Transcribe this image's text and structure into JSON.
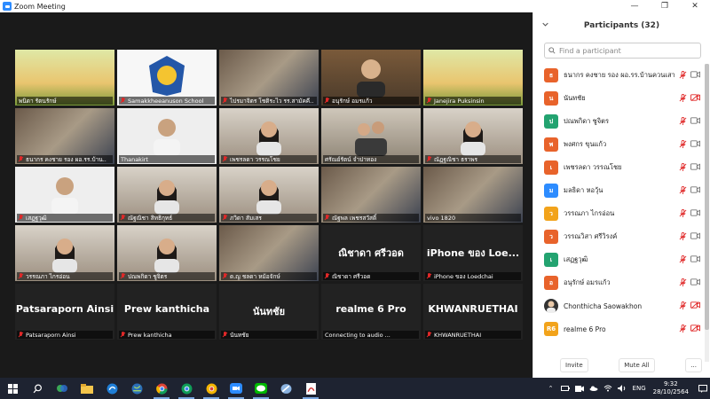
{
  "window": {
    "title": "Zoom Meeting"
  },
  "gallery": {
    "tiles": [
      {
        "name": "พนิดา รัตนรักษ์",
        "kind": "cam",
        "muted": false,
        "scene": "poster"
      },
      {
        "name": "Samakkheeanuson School",
        "kind": "cam",
        "muted": true,
        "scene": "logo"
      },
      {
        "name": "ไปรมาจิตร โชติระไว รร.สามัคคี..",
        "kind": "cam",
        "muted": true,
        "scene": "room"
      },
      {
        "name": "อนุรักษ์ อมรแก้ว",
        "kind": "cam",
        "muted": true,
        "scene": "person"
      },
      {
        "name": "Janejira Puksinsin",
        "kind": "cam",
        "muted": true,
        "scene": "poster"
      },
      {
        "name": "ธนากร คงชาย รอง ผอ.รร.บ้าน..",
        "kind": "cam",
        "muted": true,
        "scene": "room"
      },
      {
        "name": "Thanakirt",
        "kind": "cam",
        "muted": false,
        "scene": "kid"
      },
      {
        "name": "เพชรลดา วรรณโชย",
        "kind": "cam",
        "muted": true,
        "scene": "girl"
      },
      {
        "name": "ศรัณย์รัตน์ จำปาทอง",
        "kind": "cam",
        "muted": false,
        "scene": "group",
        "active": true
      },
      {
        "name": "ณัฏฐณิชา ธราพร",
        "kind": "cam",
        "muted": true,
        "scene": "girl"
      },
      {
        "name": "เสฏฐวุฒิ",
        "kind": "cam",
        "muted": true,
        "scene": "kid"
      },
      {
        "name": "ณัฐณิชา สิทธิกุทธ์",
        "kind": "cam",
        "muted": true,
        "scene": "girl"
      },
      {
        "name": "ภวิดา สัมเสร",
        "kind": "cam",
        "muted": true,
        "scene": "girl"
      },
      {
        "name": "ณัฐพล เพชรสวัสดิ์",
        "kind": "cam",
        "muted": true,
        "scene": "room"
      },
      {
        "name": "vivo 1820",
        "kind": "cam",
        "muted": false,
        "scene": "room"
      },
      {
        "name": "วรรณภา ไกรอ่อน",
        "kind": "cam",
        "muted": true,
        "scene": "girl"
      },
      {
        "name": "ปณพกิดา ชูจิตร",
        "kind": "cam",
        "muted": true,
        "scene": "girl"
      },
      {
        "name": "ด.ญ ชลดา หม้อจักษ์",
        "kind": "cam",
        "muted": true,
        "scene": "room"
      },
      {
        "name": "ณิชาดา ศรีวอด",
        "kind": "name",
        "big": "ณิชาดา ศรีวอด",
        "muted": true
      },
      {
        "name": "iPhone ของ Loedchai",
        "kind": "name",
        "big": "iPhone ของ Loe...",
        "muted": true
      },
      {
        "name": "Patsaraporn Ainsi",
        "kind": "name",
        "big": "Patsaraporn Ainsi",
        "muted": true
      },
      {
        "name": "Prew kanthicha",
        "kind": "name",
        "big": "Prew kanthicha",
        "muted": true
      },
      {
        "name": "นันทชัย",
        "kind": "name",
        "big": "นันทชัย",
        "muted": true
      },
      {
        "name": "Connecting to audio ...",
        "kind": "name",
        "big": "realme 6 Pro",
        "muted": false
      },
      {
        "name": "KHWANRUETHAI",
        "kind": "name",
        "big": "KHWANRUETHAI",
        "muted": true
      }
    ]
  },
  "participants": {
    "title": "Participants (32)",
    "search_placeholder": "Find a participant",
    "list": [
      {
        "initial": "ธ",
        "name": "ธนากร คงชาย รอง ผอ.รร.บ้านควนเสาธ",
        "color": "#e8632b",
        "video_off": false
      },
      {
        "initial": "น",
        "name": "นันทชัย",
        "color": "#e8632b",
        "video_off": true
      },
      {
        "initial": "ป",
        "name": "ปณพกิดา ชูจิตร",
        "color": "#23a370",
        "video_off": false
      },
      {
        "initial": "พ",
        "name": "พงศกร ขุนแก้ว",
        "color": "#e8632b",
        "video_off": false
      },
      {
        "initial": "เ",
        "name": "เพชรลดา วรรณโชย",
        "color": "#e8632b",
        "video_off": false
      },
      {
        "initial": "ม",
        "name": "มลธิดา หอวุ้น",
        "color": "#2d8cff",
        "video_off": false
      },
      {
        "initial": "ว",
        "name": "วรรณภา ไกรอ่อน",
        "color": "#f2a31b",
        "video_off": false
      },
      {
        "initial": "ว",
        "name": "วรรณวิสา ศรีวิรงค์",
        "color": "#e8632b",
        "video_off": false
      },
      {
        "initial": "เ",
        "name": "เสฏฐวุฒิ",
        "color": "#23a370",
        "video_off": false
      },
      {
        "initial": "อ",
        "name": "อนุรักษ์ อมรแก้ว",
        "color": "#e8632b",
        "video_off": false
      },
      {
        "initial": "",
        "name": "Chonthicha Saowakhon",
        "color": "#333333",
        "video_off": true,
        "photo": true
      },
      {
        "initial": "R6",
        "name": "realme 6 Pro",
        "color": "#f2a31b",
        "video_off": true
      }
    ],
    "invite": "Invite",
    "mute_all": "Mute All",
    "more": "..."
  },
  "taskbar": {
    "time": "9:32",
    "date": "28/10/2564",
    "lang": "ENG"
  }
}
